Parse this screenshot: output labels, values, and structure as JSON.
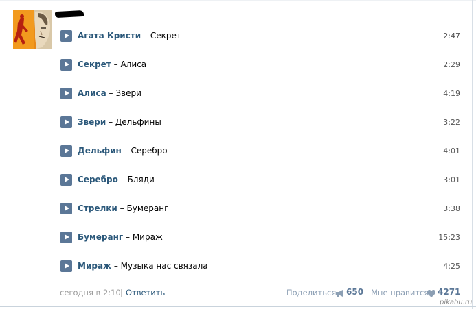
{
  "post": {
    "tracks": [
      {
        "artist": "Агата Кристи",
        "title": "Секрет",
        "duration": "2:47"
      },
      {
        "artist": "Секрет",
        "title": "Алиса",
        "duration": "2:29"
      },
      {
        "artist": "Алиса",
        "title": "Звери",
        "duration": "4:19"
      },
      {
        "artist": "Звери",
        "title": "Дельфины",
        "duration": "3:22"
      },
      {
        "artist": "Дельфин",
        "title": "Серебро",
        "duration": "4:01"
      },
      {
        "artist": "Серебро",
        "title": "Бляди",
        "duration": "3:01"
      },
      {
        "artist": "Стрелки",
        "title": "Бумеранг",
        "duration": "3:38"
      },
      {
        "artist": "Бумеранг",
        "title": "Мираж",
        "duration": "15:23"
      },
      {
        "artist": "Мираж",
        "title": "Музыка нас связала",
        "duration": "4:25"
      }
    ],
    "separator": "–",
    "footer": {
      "date": "сегодня в 2:10",
      "divider": "|",
      "reply_label": "Ответить",
      "share_label": "Поделиться",
      "share_count": "650",
      "like_label": "Мне нравится",
      "like_count": "4271"
    }
  },
  "watermark": "pikabu.ru",
  "colors": {
    "link": "#2b587a",
    "play_button": "#5b7797",
    "muted": "#999999",
    "count": "#5b7797"
  },
  "icons": {
    "play": "play-icon",
    "share": "megaphone-icon",
    "like": "heart-icon"
  }
}
